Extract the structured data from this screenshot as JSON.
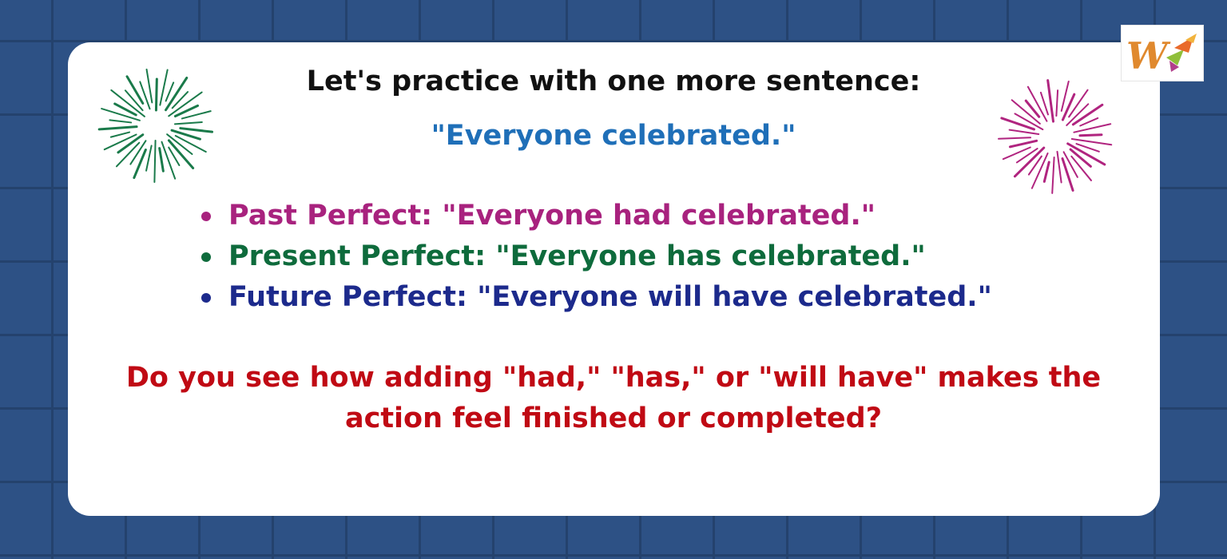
{
  "heading": "Let's practice with one more sentence:",
  "example": "\"Everyone celebrated.\"",
  "tenses": [
    {
      "text": "Past Perfect: \"Everyone had celebrated.\"",
      "color": "#a8227e"
    },
    {
      "text": "Present Perfect: \"Everyone has celebrated.\"",
      "color": "#0e6b3c"
    },
    {
      "text": "Future Perfect: \"Everyone will have celebrated.\"",
      "color": "#1c2a8c"
    }
  ],
  "question": "Do you see how adding \"had,\" \"has,\" or \"will have\" makes the action feel finished or completed?",
  "colors": {
    "background": "#2d5185",
    "card": "#ffffff",
    "heading": "#111111",
    "example": "#1f6fb8",
    "question": "#c00a14",
    "firework_left": "#1a7a4a",
    "firework_right": "#b0247f"
  },
  "icons": {
    "logo": "logo-w-icon",
    "firework_left": "firework-icon",
    "firework_right": "firework-icon"
  }
}
